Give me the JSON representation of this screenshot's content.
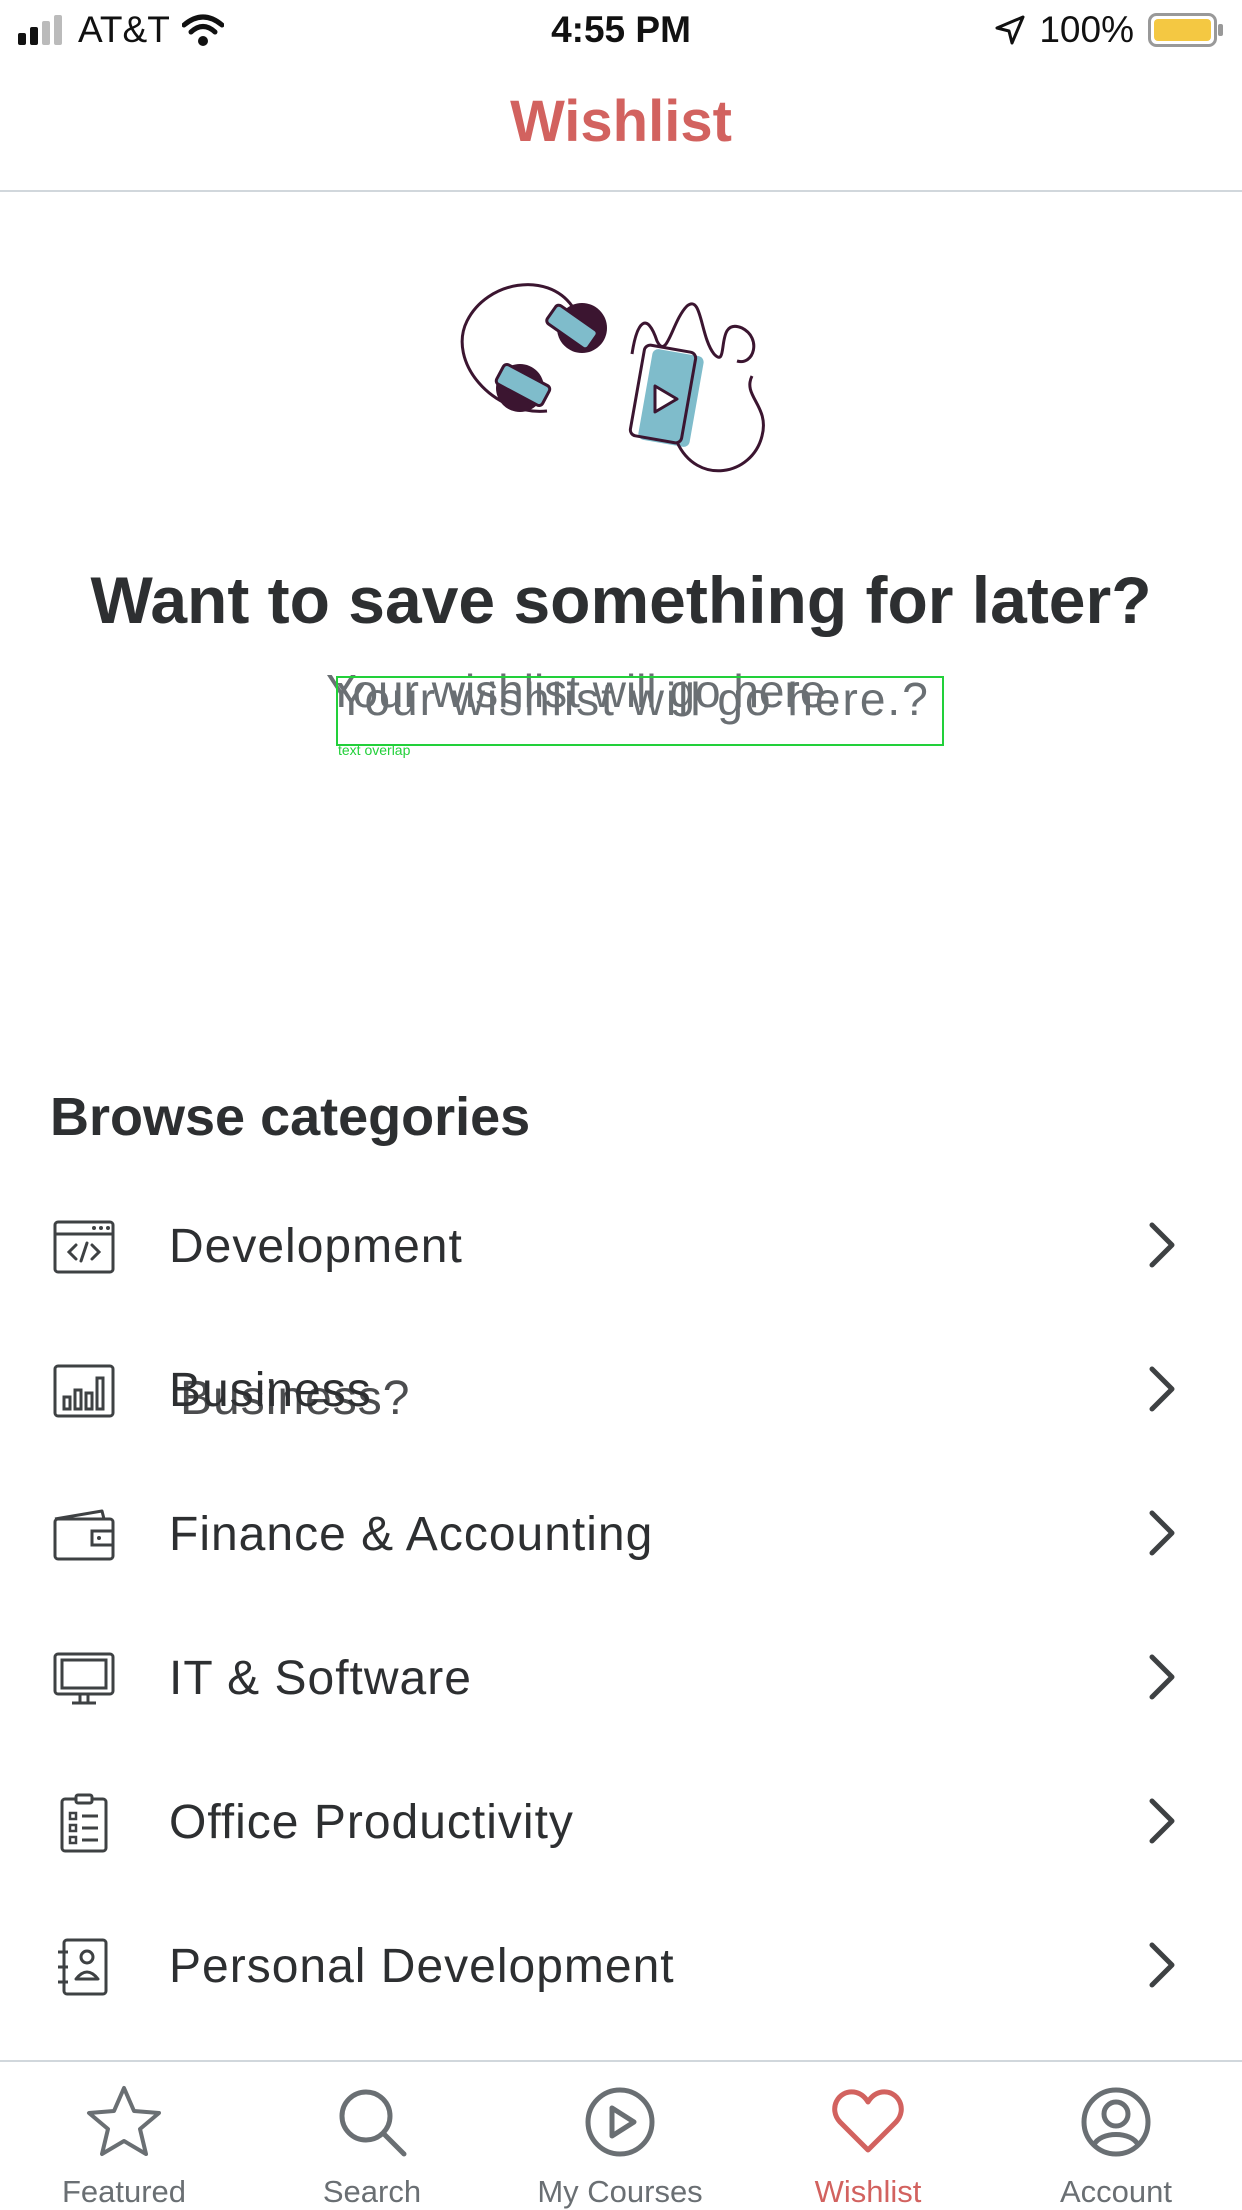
{
  "status_bar": {
    "carrier": "AT&T",
    "time": "4:55 PM",
    "battery": "100%"
  },
  "nav": {
    "title": "Wishlist"
  },
  "empty_state": {
    "title": "Want to save something for later?",
    "subtitle_ghost": "Your wishlist will go here.",
    "subtitle": "Your wishlist will go here.?",
    "overlap_note": "text overlap"
  },
  "browse": {
    "title": "Browse categories",
    "categories": [
      {
        "label": "Development",
        "icon": "code-window-icon"
      },
      {
        "label": "Business",
        "ghost": "Business?",
        "icon": "bar-chart-icon"
      },
      {
        "label": "Finance & Accounting",
        "icon": "wallet-icon"
      },
      {
        "label": "IT & Software",
        "icon": "monitor-icon"
      },
      {
        "label": "Office Productivity",
        "icon": "clipboard-list-icon"
      },
      {
        "label": "Personal Development",
        "icon": "notebook-icon"
      }
    ]
  },
  "tabs": [
    {
      "label": "Featured",
      "icon": "star-icon"
    },
    {
      "label": "Search",
      "icon": "search-icon"
    },
    {
      "label": "My Courses",
      "icon": "play-circle-icon"
    },
    {
      "label": "Wishlist",
      "icon": "heart-icon",
      "active": true
    },
    {
      "label": "Account",
      "icon": "account-icon"
    }
  ],
  "colors": {
    "accent": "#d2625f",
    "text": "#2d2f31",
    "muted": "#6a6f73",
    "illustration_blue": "#7fbccb",
    "illustration_dark": "#3b1530",
    "overlap_green": "#22d03a"
  }
}
